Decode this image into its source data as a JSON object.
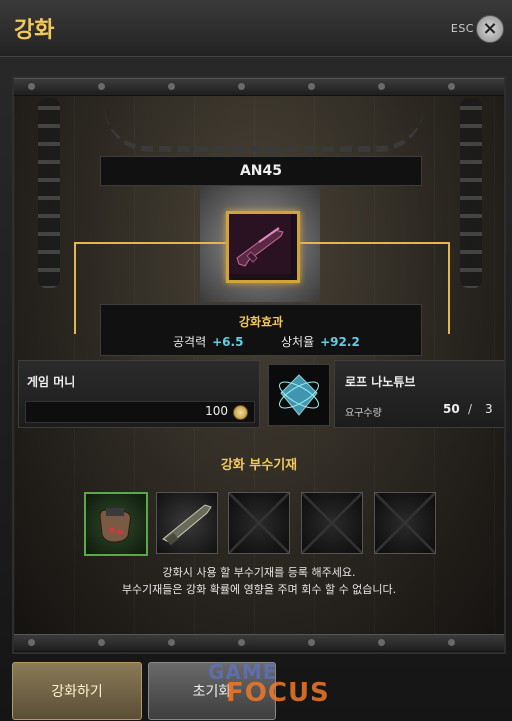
{
  "window": {
    "title": "강화",
    "esc_label": "ESC",
    "close_glyph": "×"
  },
  "item": {
    "name": "AN45",
    "icon": "rifle-icon"
  },
  "effect": {
    "title": "강화효과",
    "stats": [
      {
        "label": "공격력",
        "value": "+6.5"
      },
      {
        "label": "상처율",
        "value": "+92.2"
      }
    ]
  },
  "money": {
    "label": "게임 머니",
    "amount": "100",
    "icon": "coin-icon"
  },
  "material": {
    "name": "로프 나노튜브",
    "icon": "nanotube-crystal-icon",
    "req_label": "요구수량",
    "have": "50",
    "separator": "/",
    "need": "3"
  },
  "aux": {
    "title": "강화 부수기재",
    "slots": [
      {
        "state": "filled",
        "icon": "glove-icon"
      },
      {
        "state": "filled",
        "icon": "rifle-part-icon"
      },
      {
        "state": "empty"
      },
      {
        "state": "empty"
      },
      {
        "state": "empty"
      }
    ],
    "notice_lines": [
      "강화시 사용 할 부수기재를 등록 해주세요.",
      "부수기재들은 강화 확률에 영향을 주며 회수 할 수 없습니다."
    ]
  },
  "buttons": {
    "enhance": "강화하기",
    "reset": "초기화"
  },
  "watermark": {
    "line1": "GAME",
    "line2": "FOCUS"
  },
  "colors": {
    "accent_gold": "#f3c85a",
    "stat_blue": "#5fcfe6",
    "frame_gold": "#e4b64f"
  }
}
